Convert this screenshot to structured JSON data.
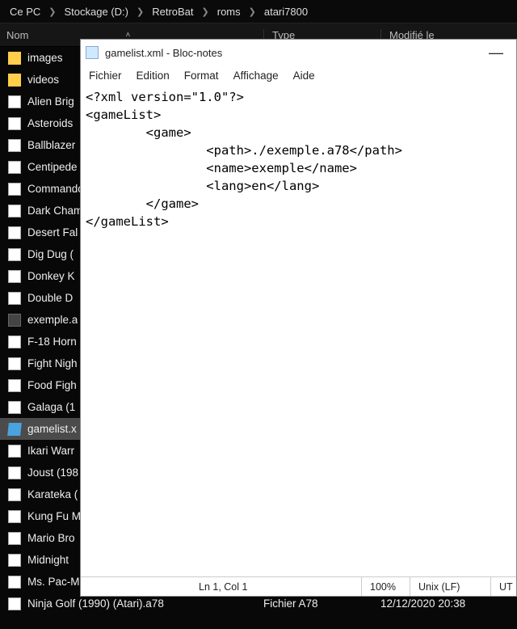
{
  "breadcrumbs": [
    "Ce PC",
    "Stockage (D:)",
    "RetroBat",
    "roms",
    "atari7800"
  ],
  "columns": {
    "name": "Nom",
    "type": "Type",
    "modified": "Modifié le"
  },
  "files": [
    {
      "name": "images",
      "icon": "folder"
    },
    {
      "name": "videos",
      "icon": "folder"
    },
    {
      "name": "Alien Brig",
      "icon": "file"
    },
    {
      "name": "Asteroids",
      "icon": "file"
    },
    {
      "name": "Ballblazer",
      "icon": "file"
    },
    {
      "name": "Centipede",
      "icon": "file"
    },
    {
      "name": "Commando",
      "icon": "file"
    },
    {
      "name": "Dark Cham",
      "icon": "file"
    },
    {
      "name": "Desert Fal",
      "icon": "file"
    },
    {
      "name": "Dig Dug (",
      "icon": "file"
    },
    {
      "name": "Donkey K",
      "icon": "file"
    },
    {
      "name": "Double D",
      "icon": "file"
    },
    {
      "name": "exemple.a",
      "icon": "file-dark"
    },
    {
      "name": "F-18 Horn",
      "icon": "file"
    },
    {
      "name": "Fight Nigh",
      "icon": "file"
    },
    {
      "name": "Food Figh",
      "icon": "file"
    },
    {
      "name": "Galaga (1",
      "icon": "file"
    },
    {
      "name": "gamelist.x",
      "icon": "gamelist",
      "selected": true
    },
    {
      "name": "Ikari Warr",
      "icon": "file"
    },
    {
      "name": "Joust (198",
      "icon": "file"
    },
    {
      "name": "Karateka (",
      "icon": "file"
    },
    {
      "name": "Kung Fu M",
      "icon": "file"
    },
    {
      "name": "Mario Bro",
      "icon": "file"
    },
    {
      "name": "Midnight",
      "icon": "file"
    },
    {
      "name": "Ms. Pac-M",
      "icon": "file"
    },
    {
      "name": "Ninja Golf (1990) (Atari).a78",
      "icon": "file",
      "type": "Fichier A78",
      "modified": "12/12/2020 20:38"
    }
  ],
  "notepad": {
    "title": "gamelist.xml - Bloc-notes",
    "menu": [
      "Fichier",
      "Edition",
      "Format",
      "Affichage",
      "Aide"
    ],
    "content": "<?xml version=\"1.0\"?>\n<gameList>\n        <game>\n                <path>./exemple.a78</path>\n                <name>exemple</name>\n                <lang>en</lang>\n        </game>\n</gameList>",
    "status": {
      "position": "Ln 1, Col 1",
      "zoom": "100%",
      "eol": "Unix (LF)",
      "encoding": "UT"
    }
  }
}
